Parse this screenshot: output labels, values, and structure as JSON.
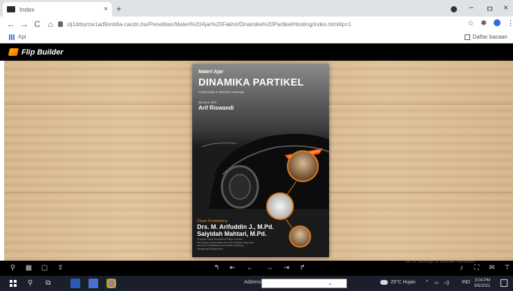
{
  "browser": {
    "tab_title": "Index",
    "tab_close": "×",
    "new_tab": "+",
    "url": "zij1drbyrzw1ad9onb6a-cacdn.hw/Penelitian/Materi%20Ajar%20Fakhri/Dinamika%20Partikel/Hosting/index.html#p=1",
    "nav": {
      "back": "←",
      "forward": "→",
      "reload": "C",
      "home": "⌂"
    },
    "window_controls": {
      "minimize": "−",
      "maximize": "ㅁ",
      "close": "×"
    },
    "toolbar_icons": [
      "star-icon",
      "extension-icon",
      "profile-icon",
      "menu-icon"
    ],
    "bookmarks": {
      "apps_label": "Apl",
      "reading_list_label": "Daftar bacaan"
    }
  },
  "flipbook": {
    "brand": "Flip Builder",
    "cover": {
      "label": "Materi Ajar",
      "title": "DINAMIKA PARTIKEL",
      "subtitle": "Untuk kelas X SMA/MA sederajat",
      "by_label": "Disusun oleh",
      "author": "Arif Riswandi",
      "teacher_label": "Dosen Pembimbing",
      "teacher1": "Drs. M. Arifuddin J., M.Pd.",
      "teacher2": "Saiyidah Mahtari, M.Pd.",
      "fine_print": "Program Studi Pendidikan Fisika Jurusan Pendidikan Matematika dan IPA Fakultas Keguruan dan Ilmu Pendidikan Universitas Lambung Mangkurat Banjarmasin"
    },
    "toolbar_left": [
      "zoom-icon",
      "thumbnails-icon",
      "bookmark-icon",
      "share-icon"
    ],
    "toolbar_center": [
      "first-page-icon",
      "prev-section-icon",
      "prev-page-icon",
      "next-page-icon",
      "next-section-icon",
      "last-page-icon"
    ],
    "toolbar_right": [
      "sound-icon",
      "fullscreen-icon",
      "email-icon",
      "more-icon"
    ],
    "watermark": "Go to Settings to activate Windows."
  },
  "taskbar": {
    "address_label": "Address",
    "weather": "29°C Hujan",
    "lang": "IND",
    "time": "3:04 PM",
    "date": "9/5/2021"
  }
}
